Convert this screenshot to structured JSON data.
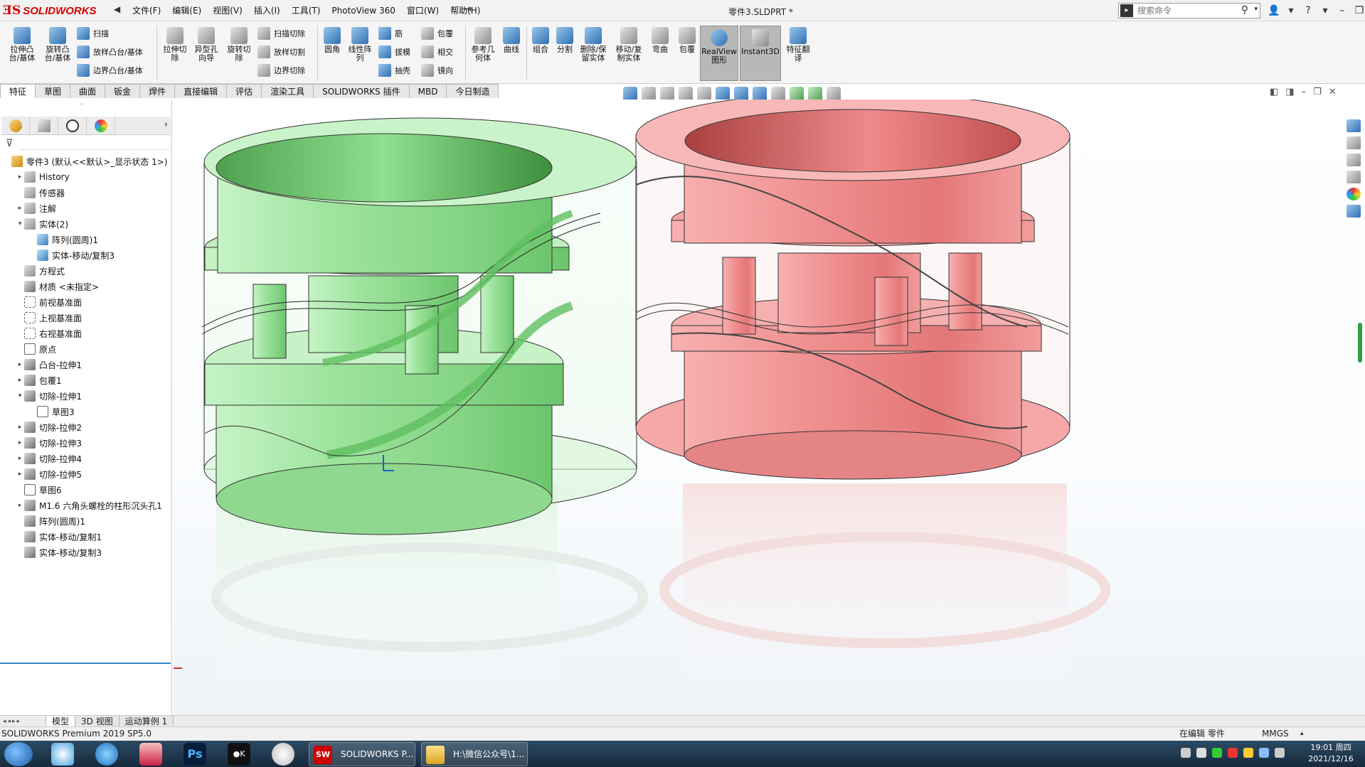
{
  "app": {
    "brand_ds": "ƎS",
    "brand_name": "SOLIDWORKS",
    "doc_title": "零件3.SLDPRT *"
  },
  "menu": [
    "文件(F)",
    "编辑(E)",
    "视图(V)",
    "插入(I)",
    "工具(T)",
    "PhotoView 360",
    "窗口(W)",
    "帮助(H)"
  ],
  "search": {
    "placeholder": "搜索命令"
  },
  "ribbon": {
    "extrude_boss": "拉伸凸\n台/基体",
    "revolve_boss": "旋转凸\n台/基体",
    "sweep": "扫描",
    "loft": "放样凸台/基体",
    "boundary_boss": "边界凸台/基体",
    "extrude_cut": "拉伸切\n除",
    "hole_wizard": "异型孔\n向导",
    "revolve_cut": "旋转切\n除",
    "swept_cut": "扫描切除",
    "lofted_cut": "放样切割",
    "boundary_cut": "边界切除",
    "fillet": "圆角",
    "linear_pattern": "线性阵\n列",
    "rib": "筋",
    "draft": "拔模",
    "shell": "抽壳",
    "wrap": "包覆",
    "intersect": "相交",
    "mirror": "镜向",
    "ref_geometry": "参考几\n何体",
    "curves": "曲线",
    "combine": "组合",
    "split": "分割",
    "delete_keep_body": "删除/保\n留实体",
    "move_copy_body": "移动/复\n制实体",
    "flex": "弯曲",
    "wrap2": "包覆",
    "realview": "RealView\n图形",
    "instant3d": "Instant3D",
    "feature_translate": "特征翻\n译"
  },
  "tabs": [
    "特征",
    "草图",
    "曲面",
    "钣金",
    "焊件",
    "直接编辑",
    "评估",
    "渲染工具",
    "SOLIDWORKS 插件",
    "MBD",
    "今日制造"
  ],
  "tree": [
    {
      "label": "零件3  (默认<<默认>_显示状态 1>)",
      "toggle": "",
      "icon": "part",
      "indent": 0
    },
    {
      "label": "History",
      "toggle": "▸",
      "icon": "folder",
      "indent": 1
    },
    {
      "label": "传感器",
      "toggle": "",
      "icon": "folder",
      "indent": 1
    },
    {
      "label": "注解",
      "toggle": "▸",
      "icon": "folder",
      "indent": 1
    },
    {
      "label": "实体(2)",
      "toggle": "▾",
      "icon": "folder",
      "indent": 1
    },
    {
      "label": "阵列(圆周)1",
      "toggle": "",
      "icon": "body",
      "indent": 2
    },
    {
      "label": "实体-移动/复制3",
      "toggle": "",
      "icon": "body",
      "indent": 2
    },
    {
      "label": "方程式",
      "toggle": "",
      "icon": "folder",
      "indent": 1
    },
    {
      "label": "材质 <未指定>",
      "toggle": "",
      "icon": "feat",
      "indent": 1
    },
    {
      "label": "前视基准面",
      "toggle": "",
      "icon": "plane",
      "indent": 1
    },
    {
      "label": "上视基准面",
      "toggle": "",
      "icon": "plane",
      "indent": 1
    },
    {
      "label": "右视基准面",
      "toggle": "",
      "icon": "plane",
      "indent": 1
    },
    {
      "label": "原点",
      "toggle": "",
      "icon": "sketch",
      "indent": 1
    },
    {
      "label": "凸台-拉伸1",
      "toggle": "▸",
      "icon": "feat",
      "indent": 1
    },
    {
      "label": "包覆1",
      "toggle": "▸",
      "icon": "feat",
      "indent": 1
    },
    {
      "label": "切除-拉伸1",
      "toggle": "▾",
      "icon": "feat",
      "indent": 1
    },
    {
      "label": "草图3",
      "toggle": "",
      "icon": "sketch",
      "indent": 2
    },
    {
      "label": "切除-拉伸2",
      "toggle": "▸",
      "icon": "feat",
      "indent": 1
    },
    {
      "label": "切除-拉伸3",
      "toggle": "▸",
      "icon": "feat",
      "indent": 1
    },
    {
      "label": "切除-拉伸4",
      "toggle": "▸",
      "icon": "feat",
      "indent": 1
    },
    {
      "label": "切除-拉伸5",
      "toggle": "▸",
      "icon": "feat",
      "indent": 1
    },
    {
      "label": "草图6",
      "toggle": "",
      "icon": "sketch",
      "indent": 1
    },
    {
      "label": "M1.6 六角头螺栓的柱形沉头孔1",
      "toggle": "▸",
      "icon": "feat",
      "indent": 1
    },
    {
      "label": "阵列(圆周)1",
      "toggle": "",
      "icon": "feat",
      "indent": 1
    },
    {
      "label": "实体-移动/复制1",
      "toggle": "",
      "icon": "feat",
      "indent": 1
    },
    {
      "label": "实体-移动/复制3",
      "toggle": "",
      "icon": "feat",
      "indent": 1
    }
  ],
  "model_tabs": [
    "模型",
    "3D 视图",
    "运动算例 1"
  ],
  "status": {
    "product": "SOLIDWORKS Premium 2019 SP5.0",
    "edit_mode": "在编辑 零件",
    "units": "MMGS"
  },
  "taskbar": {
    "task1": "SOLIDWORKS P...",
    "task2": "H:\\微信公众号\\1...",
    "time": "19:01 周四",
    "date": "2021/12/16"
  },
  "colors": {
    "green_body": "#b9f0b9",
    "red_body": "#f08a8a",
    "accent": "#d40000"
  }
}
